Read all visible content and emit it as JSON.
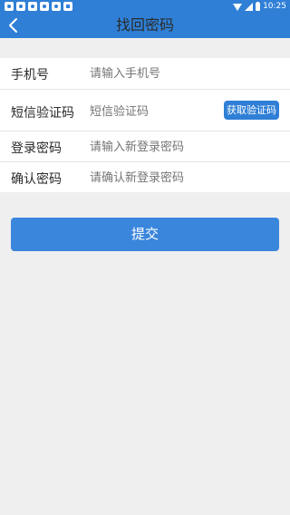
{
  "status_bar": {
    "time": "10:25",
    "notification_icons": [
      "app-icon",
      "app-icon",
      "app-icon",
      "app-icon",
      "app-icon",
      "image-icon"
    ]
  },
  "header": {
    "title": "找回密码",
    "back_icon": "chevron-left-icon"
  },
  "form": {
    "phone": {
      "label": "手机号",
      "placeholder": "请输入手机号"
    },
    "sms_code": {
      "label": "短信验证码",
      "placeholder": "短信验证码",
      "button": "获取验证码"
    },
    "new_password": {
      "label": "登录密码",
      "placeholder": "请输入新登录密码"
    },
    "confirm_password": {
      "label": "确认密码",
      "placeholder": "请确认新登录密码"
    }
  },
  "submit": {
    "label": "提交"
  },
  "colors": {
    "primary": "#2f7fd6",
    "background": "#efefef"
  }
}
